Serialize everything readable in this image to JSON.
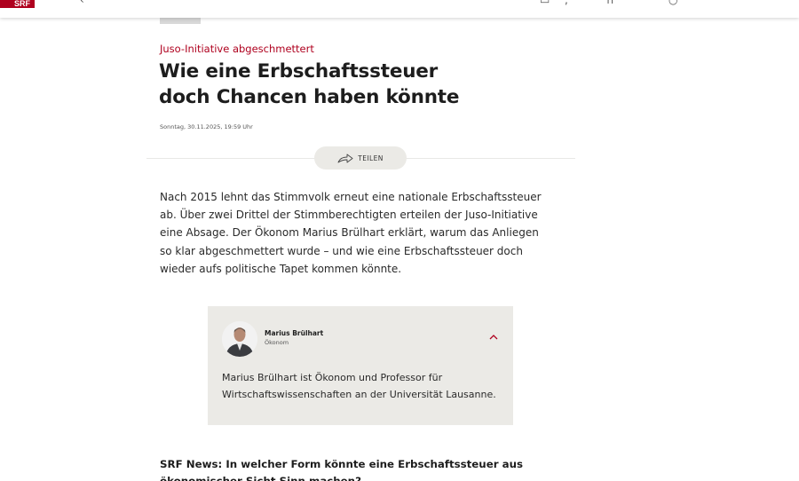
{
  "header": {
    "logo": "SRF",
    "logo_color": "#af001e"
  },
  "article": {
    "kicker": "Juso-Initiative abgeschmettert",
    "title_line1": "Wie eine Erbschaftssteuer",
    "title_line2": "doch Chancen haben könnte",
    "date": "Sonntag, 30.11.2025, 19:59 Uhr",
    "share_label": "TEILEN",
    "lead": "Nach 2015 lehnt das Stimmvolk erneut eine nationale Erbschaftssteuer ab. Über zwei Drittel der Stimmberechtigten erteilen der Juso-Initiative eine Absage. Der Ökonom Marius Brülhart erklärt, warum das Anliegen so klar abgeschmettert wurde – und wie eine Erbschaftssteuer doch wieder aufs politische Tapet kommen könnte.",
    "person": {
      "name": "Marius Brülhart",
      "role": "Ökonom",
      "bio": "Marius Brülhart ist Ökonom und Professor für Wirtschaftswissenschaften an der Universität Lausanne."
    },
    "question": "SRF News: In welcher Form könnte eine Erbschaftssteuer aus ökonomischer Sicht Sinn machen?"
  },
  "icons": {
    "tv": "tv-icon",
    "audio": "headphones-icon",
    "search": "search-icon",
    "share": "share-arrow-icon",
    "collapse": "chevron-up-icon"
  },
  "colors": {
    "accent": "#af001e",
    "box_bg": "#ebeae6"
  }
}
